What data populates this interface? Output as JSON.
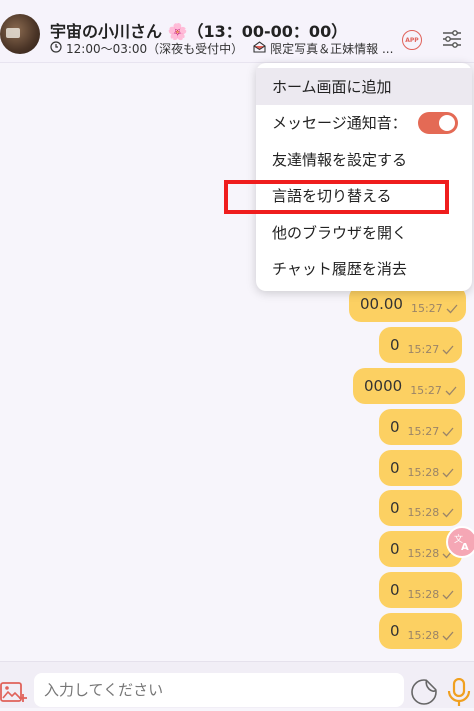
{
  "header": {
    "title": "宇宙の小川さん 🌸（13：00-00：00）",
    "hours": "12:00〜03:00（深夜も受付中）",
    "notice": "限定写真＆正妹情報 ...",
    "app_badge": "APP"
  },
  "menu": {
    "items": [
      {
        "label": "ホーム画面に追加"
      },
      {
        "label": "メッセージ通知音："
      },
      {
        "label": "友達情報を設定する"
      },
      {
        "label": "言語を切り替える"
      },
      {
        "label": "他のブラウザを開く"
      },
      {
        "label": "チャット履歴を消去"
      }
    ],
    "sound_toggle_on": true
  },
  "messages": [
    {
      "text": "00.00",
      "time": "15:27"
    },
    {
      "text": "0",
      "time": "15:27"
    },
    {
      "text": "0000",
      "time": "15:27"
    },
    {
      "text": "0",
      "time": "15:27"
    },
    {
      "text": "0",
      "time": "15:28"
    },
    {
      "text": "0",
      "time": "15:28"
    },
    {
      "text": "0",
      "time": "15:28"
    },
    {
      "text": "0",
      "time": "15:28"
    },
    {
      "text": "0",
      "time": "15:28"
    }
  ],
  "input": {
    "placeholder": "入力してください"
  },
  "colors": {
    "bubble": "#fcd062",
    "accent": "#e46a55",
    "highlight": "#ef1d1d",
    "mic": "#f0a020"
  },
  "icons": {
    "clock": "clock-icon",
    "notice": "envelope-icon",
    "settings": "sliders-icon",
    "image": "image-add-icon",
    "sticker": "sticker-icon",
    "mic": "microphone-icon",
    "translate": "translate-icon",
    "check": "check-icon"
  }
}
